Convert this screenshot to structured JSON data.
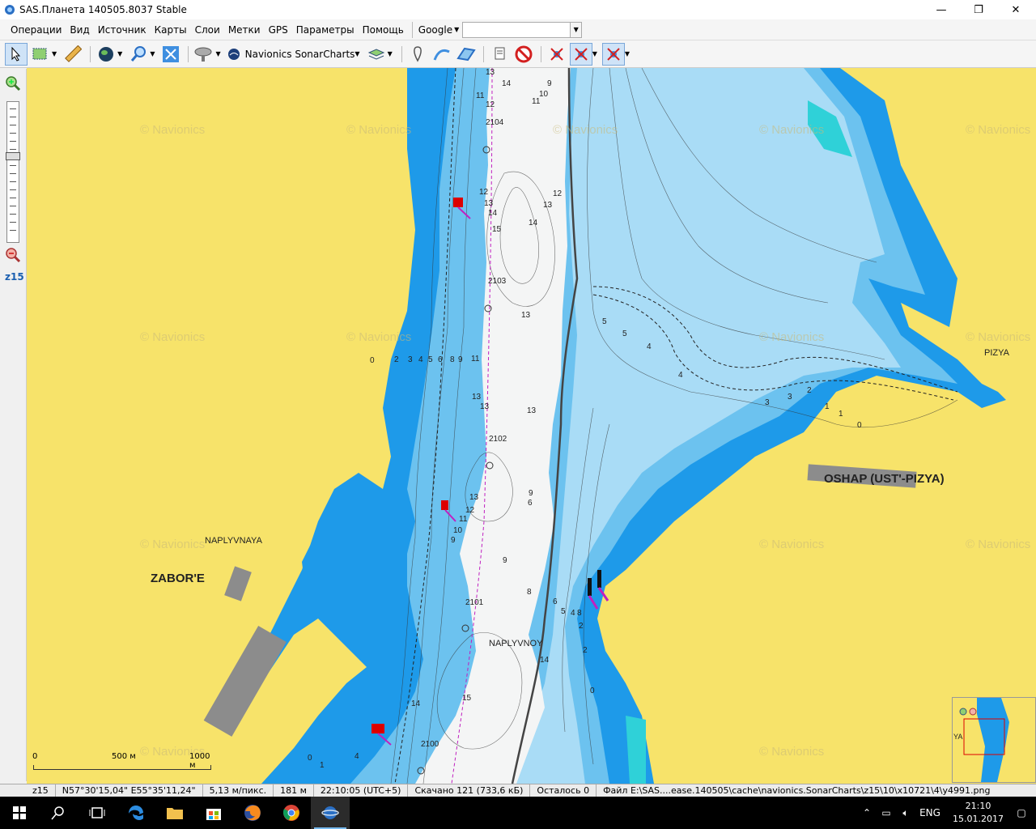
{
  "window": {
    "title": "SAS.Планета 140505.8037 Stable",
    "minimize": "—",
    "maximize": "❐",
    "close": "✕"
  },
  "menu": {
    "items": [
      "Операции",
      "Вид",
      "Источник",
      "Карты",
      "Слои",
      "Метки",
      "GPS",
      "Параметры",
      "Помощь"
    ],
    "google": "Google"
  },
  "toolbar": {
    "sonar_label": "Navionics SonarCharts"
  },
  "left": {
    "zoom_level": "z15"
  },
  "map": {
    "places": {
      "zabore": "ZABOR'E",
      "naplyvnaya": "NAPLYVNAYA",
      "naplyvnoy": "NAPLYVNOY",
      "oshap": "OSHAP (UST'-PIZYA)",
      "pizya": "PIZYA",
      "ya": "YA"
    },
    "watermark": "© Navionics",
    "depths": [
      "13",
      "14",
      "9",
      "11",
      "12",
      "10",
      "11",
      "2104",
      "12",
      "12",
      "13",
      "13",
      "14",
      "15",
      "14",
      "2103",
      "13",
      "5",
      "5",
      "4",
      "4",
      "0",
      "2",
      "3",
      "4",
      "5",
      "6",
      "8",
      "9",
      "11",
      "13",
      "13",
      "13",
      "2102",
      "3",
      "3",
      "2",
      "1",
      "1",
      "0",
      "9",
      "6",
      "13",
      "12",
      "11",
      "10",
      "9",
      "9",
      "8",
      "6",
      "5",
      "4",
      "8",
      "2",
      "2101",
      "2",
      "0",
      "14",
      "15",
      "14",
      "2100",
      "4",
      "1",
      "0"
    ],
    "scale": {
      "zero": "0",
      "mid": "500 м",
      "max": "1000 м"
    }
  },
  "status": {
    "zoom": "z15",
    "coords": "N57°30'15,04\" E55°35'11,24\"",
    "resolution": "5,13 м/пикс.",
    "distance": "181 м",
    "time": "22:10:05 (UTC+5)",
    "downloaded": "Скачано 121 (733,6 кБ)",
    "remaining": "Осталось 0",
    "file": "Файл E:\\SAS....ease.140505\\cache\\navionics.SonarCharts\\z15\\10\\x10721\\4\\y4991.png"
  },
  "taskbar": {
    "lang": "ENG",
    "time": "21:10",
    "date": "15.01.2017"
  },
  "colors": {
    "land": "#f7e36a",
    "deep_white": "#f4f5f5",
    "mid_blue": "#6cc2ef",
    "shallow_blue": "#1e9ae9",
    "accent": "#1b5fb0"
  }
}
